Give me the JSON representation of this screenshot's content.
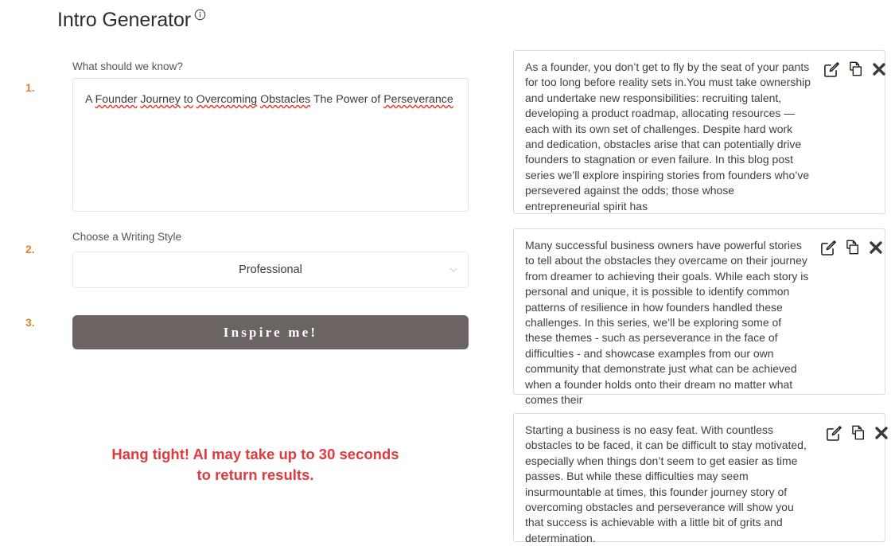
{
  "header": {
    "title": "Intro Generator",
    "info_icon": "info-circle-icon"
  },
  "form": {
    "steps": [
      "1.",
      "2.",
      "3."
    ],
    "prompt": {
      "label": "What should we know?",
      "value_line1_a": "A ",
      "value_line1_sp1": "Founder",
      "value_line1_b": " ",
      "value_line1_sp2": "Journey",
      "value_line1_c": " ",
      "value_line1_sp3": "to",
      "value_line1_d": " ",
      "value_line1_sp4": "Overcoming",
      "value_line1_e": " ",
      "value_line1_sp5": "Obstacles",
      "value_line1_f": " The Power of ",
      "value_line2_sp": "Perseverance",
      "value": "A Founder Journey to Overcoming Obstacles The Power of Perseverance",
      "placeholder": "What should we know?"
    },
    "style": {
      "label": "Choose a Writing Style",
      "selected": "Professional",
      "options": [
        "Professional"
      ],
      "chevron_icon": "chevron-down-icon"
    },
    "submit_label": "Inspire me!"
  },
  "notice": {
    "line1": "Hang tight! AI may take up to 30 seconds",
    "line2": "to return results.",
    "color": "#e03a3c"
  },
  "results": {
    "actions": {
      "edit": "edit-icon",
      "copy": "copy-icon",
      "close": "close-icon"
    },
    "cards": [
      {
        "text": "As a founder, you don’t get to fly by the seat of your pants for too long before reality sets in.You must take ownership and undertake new responsibilities: recruiting talent, developing a product roadmap, allocating resources — each with its own set of challenges. Despite hard work and dedication, obstacles arise that can potentially drive founders to stagnation or even failure. In this blog post series we’ll explore inspiring stories from founders who’ve persevered against the odds; those whose entrepreneurial spirit has"
      },
      {
        "text": "Many successful business owners have powerful stories to tell about the obstacles they overcame on their journey from dreamer to achieving their goals. While each story is personal and unique, it is possible to identify common patterns of resilience in how founders handled these challenges. In this series, we’ll be exploring some of these themes - such as perseverance in the face of difficulties - and showcase examples from our own community that demonstrate just what can be achieved when a founder holds onto their dream no matter what comes their"
      },
      {
        "text": "Starting a business is no easy feat. With countless obstacles to be faced, it can be difficult to stay motivated, especially when things don’t seem to get easier as time passes. But while these difficulties may seem insurmountable at times, this founder journey story of overcoming obstacles and perseverance will show you that success is achievable with a little bit of grits and determination."
      }
    ]
  },
  "colors": {
    "step_number": "#d9832f",
    "button_bg": "#6b6463",
    "spellcheck_underline": "#e0392c"
  }
}
